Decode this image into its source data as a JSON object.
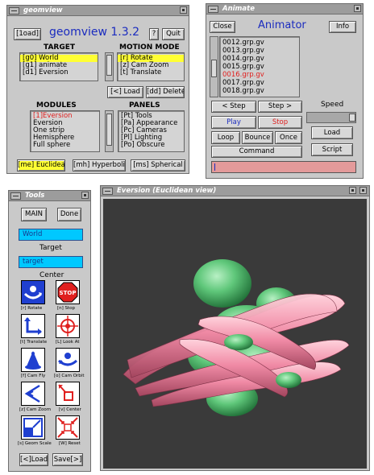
{
  "geomview": {
    "title": "geomview",
    "load_button": "[1oad]",
    "heading": "geomview 1.3.2",
    "help_button": "?",
    "quit_button": "Quit",
    "target_heading": "TARGET",
    "targets": [
      "[g0] World",
      "[g1] animate",
      "[d1] Eversion"
    ],
    "motion_heading": "MOTION MODE",
    "motion_modes": [
      "[r] Rotate",
      "[z] Cam Zoom",
      "[t] Translate"
    ],
    "load_btn2": "[<] Load",
    "delete_btn": "[dd] Delete",
    "modules_heading": "MODULES",
    "modules": [
      "[1]Eversion",
      "Eversion",
      "One strip",
      "Hemisphere",
      "Full sphere"
    ],
    "panels_heading": "PANELS",
    "panels": [
      "[Pt] Tools",
      "[Pa] Appearance",
      "[Pc] Cameras",
      "[Pl] Lighting",
      "[Po] Obscure"
    ],
    "geometry_euclidean": "[me] Euclidean",
    "geometry_hyperbolic": "[mh] Hyperbolic",
    "geometry_spherical": "[ms] Spherical"
  },
  "animate": {
    "title": "Animate",
    "close_button": "Close",
    "heading": "Animator",
    "info_button": "Info",
    "files": [
      "0012.grp.gv",
      "0013.grp.gv",
      "0014.grp.gv",
      "0015.grp.gv",
      "0016.grp.gv",
      "0017.grp.gv",
      "0018.grp.gv"
    ],
    "step_back": "< Step",
    "step_fwd": "Step >",
    "speed_label": "Speed",
    "play": "Play",
    "stop": "Stop",
    "load": "Load",
    "loop": "Loop",
    "bounce": "Bounce",
    "once": "Once",
    "script": "Script",
    "command": "Command"
  },
  "tools": {
    "title": "Tools",
    "main_button": "MAIN",
    "done_button": "Done",
    "world_value": "World",
    "target_label": "Target",
    "target_value": "target",
    "center_label": "Center",
    "buttons": [
      {
        "label": "[r] Rotate",
        "icon": "rotate-icon"
      },
      {
        "label": "[n] Stop",
        "icon": "stop-icon"
      },
      {
        "label": "[t] Translate",
        "icon": "translate-icon"
      },
      {
        "label": "[L] Look At",
        "icon": "look-at-icon"
      },
      {
        "label": "[f] Cam Fly",
        "icon": "cam-fly-icon"
      },
      {
        "label": "[o] Cam Orbit",
        "icon": "cam-orbit-icon"
      },
      {
        "label": "[z] Cam Zoom",
        "icon": "cam-zoom-icon"
      },
      {
        "label": "[v] Center",
        "icon": "center-icon"
      },
      {
        "label": "[s] Geom Scale",
        "icon": "geom-scale-icon"
      },
      {
        "label": "[W] Reset",
        "icon": "reset-icon"
      }
    ],
    "stop_sign_text": "STOP",
    "load_button": "[<]Load",
    "save_button": "Save[>]"
  },
  "viewer": {
    "title": "Eversion (Euclidean view)"
  }
}
